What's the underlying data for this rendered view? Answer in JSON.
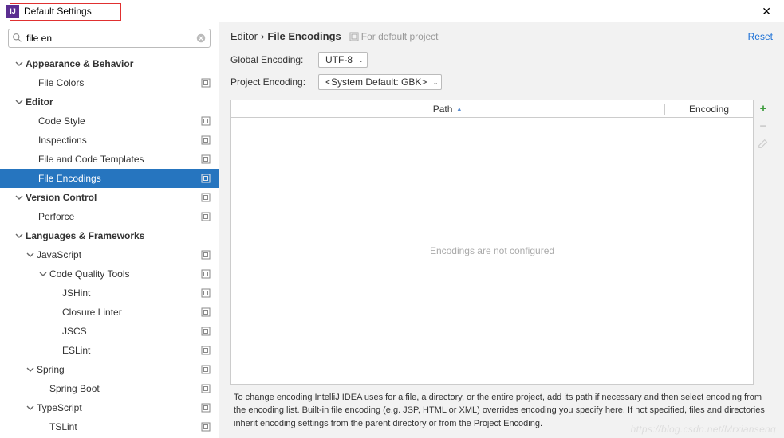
{
  "window": {
    "title": "Default Settings"
  },
  "search": {
    "value": "file en"
  },
  "sidebar": {
    "items": [
      {
        "label": "Appearance & Behavior",
        "section": true,
        "indent": 18,
        "chev": true,
        "badge": false
      },
      {
        "label": "File Colors",
        "section": false,
        "indent": 48,
        "chev": false,
        "badge": true
      },
      {
        "label": "Editor",
        "section": true,
        "indent": 18,
        "chev": true,
        "badge": false
      },
      {
        "label": "Code Style",
        "section": false,
        "indent": 48,
        "chev": false,
        "badge": true
      },
      {
        "label": "Inspections",
        "section": false,
        "indent": 48,
        "chev": false,
        "badge": true
      },
      {
        "label": "File and Code Templates",
        "section": false,
        "indent": 48,
        "chev": false,
        "badge": true
      },
      {
        "label": "File Encodings",
        "section": false,
        "indent": 48,
        "chev": false,
        "badge": true,
        "selected": true
      },
      {
        "label": "Version Control",
        "section": true,
        "indent": 18,
        "chev": true,
        "badge": true
      },
      {
        "label": "Perforce",
        "section": false,
        "indent": 48,
        "chev": false,
        "badge": true
      },
      {
        "label": "Languages & Frameworks",
        "section": true,
        "indent": 18,
        "chev": true,
        "badge": false
      },
      {
        "label": "JavaScript",
        "section": false,
        "indent": 32,
        "chev": true,
        "badge": true
      },
      {
        "label": "Code Quality Tools",
        "section": false,
        "indent": 48,
        "chev": true,
        "badge": true
      },
      {
        "label": "JSHint",
        "section": false,
        "indent": 78,
        "chev": false,
        "badge": true
      },
      {
        "label": "Closure Linter",
        "section": false,
        "indent": 78,
        "chev": false,
        "badge": true
      },
      {
        "label": "JSCS",
        "section": false,
        "indent": 78,
        "chev": false,
        "badge": true
      },
      {
        "label": "ESLint",
        "section": false,
        "indent": 78,
        "chev": false,
        "badge": true
      },
      {
        "label": "Spring",
        "section": false,
        "indent": 32,
        "chev": true,
        "badge": true
      },
      {
        "label": "Spring Boot",
        "section": false,
        "indent": 62,
        "chev": false,
        "badge": true
      },
      {
        "label": "TypeScript",
        "section": false,
        "indent": 32,
        "chev": true,
        "badge": true
      },
      {
        "label": "TSLint",
        "section": false,
        "indent": 62,
        "chev": false,
        "badge": true
      }
    ]
  },
  "breadcrumb": {
    "a": "Editor",
    "b": "File Encodings",
    "hint": "For default project",
    "reset": "Reset"
  },
  "globalEncoding": {
    "label": "Global Encoding:",
    "value": "UTF-8"
  },
  "projectEncoding": {
    "label": "Project Encoding:",
    "value": "<System Default: GBK>"
  },
  "table": {
    "header_path": "Path",
    "header_enc": "Encoding",
    "empty": "Encodings are not configured"
  },
  "footer": "To change encoding IntelliJ IDEA uses for a file, a directory, or the entire project, add its path if necessary and then select encoding from the encoding list. Built-in file encoding (e.g. JSP, HTML or XML) overrides encoding you specify here. If not specified, files and directories inherit encoding settings from the parent directory or from the Project Encoding.",
  "watermark": "https://blog.csdn.net/Mrxiansenq"
}
